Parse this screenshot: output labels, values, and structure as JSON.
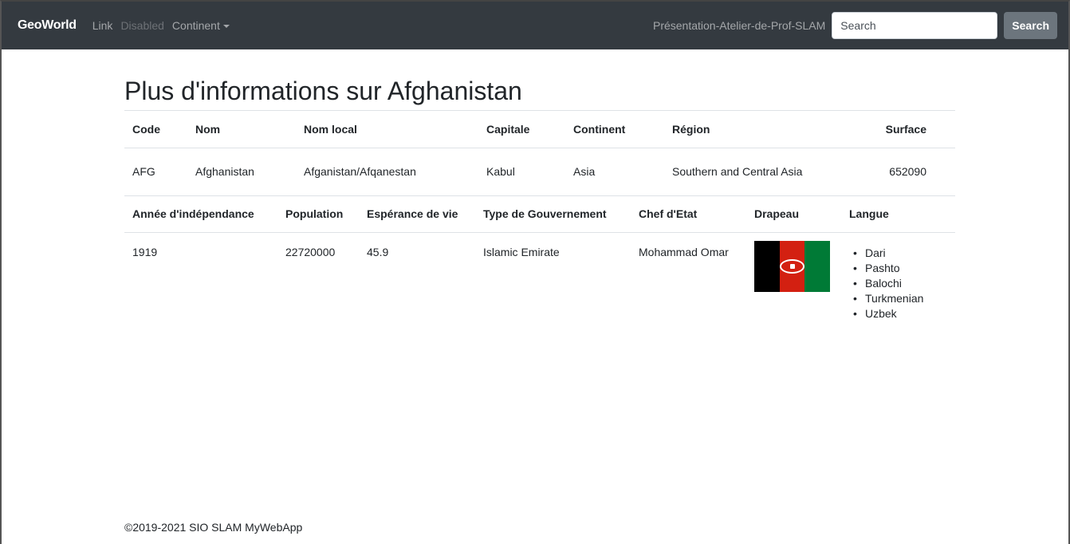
{
  "navbar": {
    "brand": "GeoWorld",
    "link": "Link",
    "disabled": "Disabled",
    "continent": "Continent",
    "right_link": "Présentation-Atelier-de-Prof-SLAM",
    "search_placeholder": "Search",
    "search_button": "Search"
  },
  "page": {
    "title": "Plus d'informations sur Afghanistan"
  },
  "table1": {
    "headers": [
      "Code",
      "Nom",
      "Nom local",
      "Capitale",
      "Continent",
      "Région",
      "Surface"
    ],
    "row": [
      "AFG",
      "Afghanistan",
      "Afganistan/Afqanestan",
      "Kabul",
      "Asia",
      "Southern and Central Asia",
      "652090"
    ]
  },
  "table2": {
    "headers": [
      "Année d'indépendance",
      "Population",
      "Espérance de vie",
      "Type de Gouvernement",
      "Chef d'Etat",
      "Drapeau",
      "Langue"
    ],
    "row": [
      "1919",
      "22720000",
      "45.9",
      "Islamic Emirate",
      "Mohammad Omar"
    ],
    "languages": [
      "Dari",
      "Pashto",
      "Balochi",
      "Turkmenian",
      "Uzbek"
    ]
  },
  "flag_colors": {
    "black": "#000000",
    "red": "#d32011",
    "green": "#007a36"
  },
  "icons": {
    "dropdown": "caret-down-icon",
    "flag": "afghanistan-flag-icon"
  },
  "footer": "©2019-2021 SIO SLAM MyWebApp"
}
